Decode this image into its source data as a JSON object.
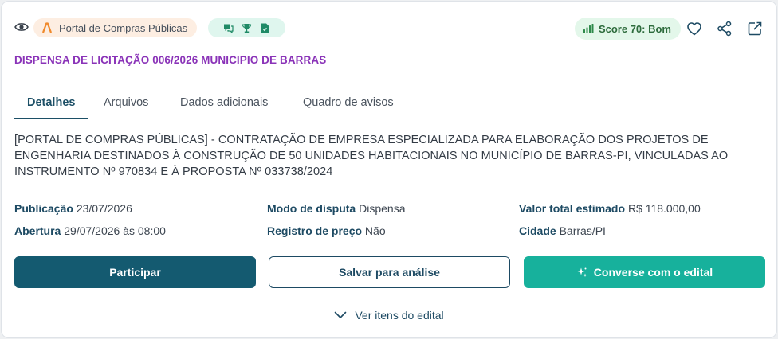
{
  "header": {
    "source_label": "Portal de Compras Públicas",
    "score_label": "Score 70: Bom",
    "icons": [
      "eye-icon",
      "portal-logo-icon",
      "chat-icon",
      "trophy-icon",
      "document-icon",
      "bar-chart-icon",
      "heart-icon",
      "share-icon",
      "external-link-icon"
    ]
  },
  "title": "DISPENSA DE LICITAÇÃO 006/2026 MUNICIPIO DE BARRAS",
  "tabs": [
    {
      "label": "Detalhes",
      "active": true
    },
    {
      "label": "Arquivos",
      "active": false
    },
    {
      "label": "Dados adicionais",
      "active": false
    },
    {
      "label": "Quadro de avisos",
      "active": false
    }
  ],
  "description": "[PORTAL DE COMPRAS PÚBLICAS] - CONTRATAÇÃO DE EMPRESA ESPECIALIZADA PARA ELABORAÇÃO DOS PROJETOS DE ENGENHARIA DESTINADOS À CONSTRUÇÃO DE 50 UNIDADES HABITACIONAIS NO MUNICÍPIO DE BARRAS-PI, VINCULADAS AO INSTRUMENTO Nº 970834 E À PROPOSTA Nº 033738/2024",
  "info": {
    "publicacao": {
      "label": "Publicação",
      "value": "23/07/2026"
    },
    "abertura": {
      "label": "Abertura",
      "value": "29/07/2026 às 08:00"
    },
    "modo_disputa": {
      "label": "Modo de disputa",
      "value": "Dispensa"
    },
    "registro_preco": {
      "label": "Registro de preço",
      "value": "Não"
    },
    "valor_total": {
      "label": "Valor total estimado",
      "value": "R$ 118.000,00"
    },
    "cidade": {
      "label": "Cidade",
      "value": "Barras/PI"
    }
  },
  "buttons": {
    "participar": "Participar",
    "salvar": "Salvar para análise",
    "converse": "Converse com o edital"
  },
  "more_label": "Ver itens do edital",
  "colors": {
    "primary": "#145a70",
    "accent_green": "#17b19c",
    "title_purple": "#8a33b8",
    "source_badge_bg": "#fdeee2",
    "score_bg": "#e3f7ea"
  }
}
